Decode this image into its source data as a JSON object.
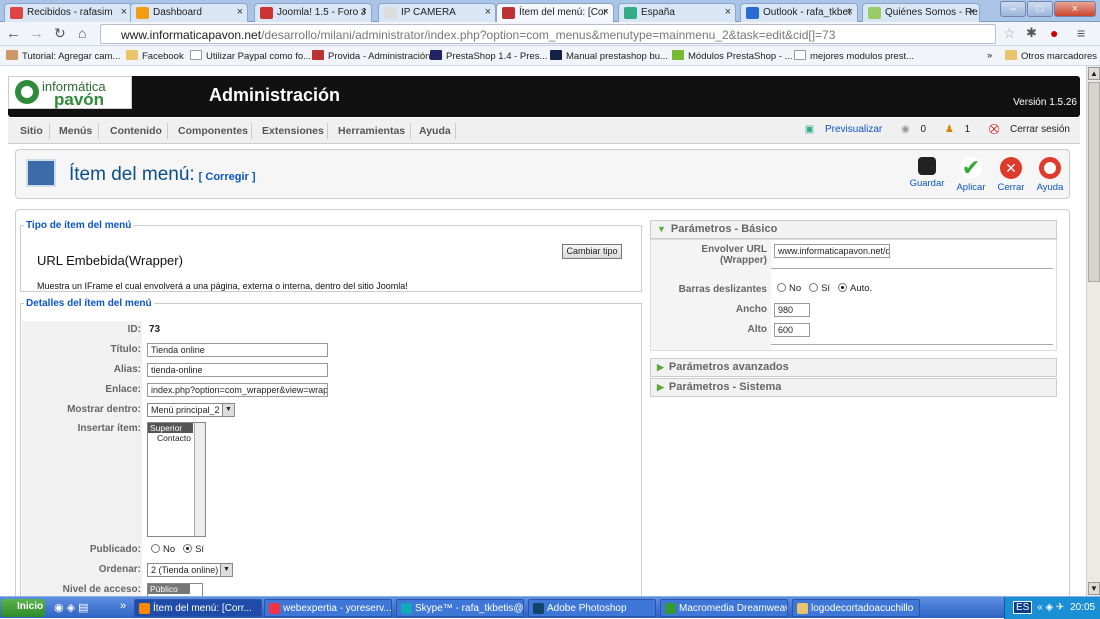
{
  "browser": {
    "tabs": [
      {
        "label": "Recibidos - rafasim",
        "icon_color": "#d44"
      },
      {
        "label": "Dashboard",
        "icon_color": "#f39c12"
      },
      {
        "label": "Joomla! 1.5 - Foro J",
        "icon_color": "#c33"
      },
      {
        "label": "IP CAMERA",
        "icon_color": "#ddd"
      },
      {
        "label": "Ítem del menú: [Cor",
        "icon_color": "#b33"
      },
      {
        "label": "España",
        "icon_color": "#3a8"
      },
      {
        "label": "Outlook - rafa_tkbet",
        "icon_color": "#2a6bd1"
      },
      {
        "label": "Quiénes Somos - Re",
        "icon_color": "#9c6"
      }
    ],
    "url_host": "www.informaticapavon.net",
    "url_path": "/desarrollo/milani/administrator/index.php?option=com_menus&menutype=mainmenu_2&task=edit&cid[]=73",
    "bookmarks": [
      "Tutorial: Agregar cam...",
      "Facebook",
      "Utilizar Paypal como fo...",
      "Provida - Administración",
      "PrestaShop 1.4 - Pres...",
      "Manual prestashop bu...",
      "Módulos PrestaShop - ...",
      "mejores modulos prest..."
    ],
    "bookmarks_overflow": "»",
    "other_bookmarks": "Otros marcadores"
  },
  "header": {
    "logo_top": "informática",
    "logo_bottom": "pavón",
    "title": "Administración",
    "version": "Versión 1.5.26"
  },
  "menu": {
    "items": [
      "Sitio",
      "Menús",
      "Contenido",
      "Componentes",
      "Extensiones",
      "Herramientas",
      "Ayuda"
    ],
    "preview": "Previsualizar",
    "messages_count": "0",
    "users_count": "1",
    "logout": "Cerrar sesión"
  },
  "toolbar": {
    "title": "Ítem del menú:",
    "subtitle": "[ Corregir ]",
    "buttons": [
      "Guardar",
      "Aplicar",
      "Cerrar",
      "Ayuda"
    ]
  },
  "tipo": {
    "legend": "Tipo de ítem del menú",
    "name": "URL Embebida(Wrapper)",
    "change_button": "Cambiar tipo",
    "description": "Muestra un IFrame el cual envolverá a una página, externa o interna, dentro del sitio Joomla!"
  },
  "detalles": {
    "legend": "Detalles del ítem del menú",
    "id_label": "ID:",
    "id_value": "73",
    "titulo_label": "Título:",
    "titulo_value": "Tienda online",
    "alias_label": "Alias:",
    "alias_value": "tienda-online",
    "enlace_label": "Enlace:",
    "enlace_value": "index.php?option=com_wrapper&view=wrapper",
    "mostrar_label": "Mostrar dentro:",
    "mostrar_value": "Menú principal_2",
    "insertar_label": "Insertar ítem:",
    "insertar_options": [
      "Superior",
      "Contacto"
    ],
    "publicado_label": "Publicado:",
    "no": "No",
    "si": "Sí",
    "ordenar_label": "Ordenar:",
    "ordenar_value": "2 (Tienda online)",
    "nivel_label": "Nivel de acceso:",
    "nivel_value": "Público"
  },
  "params_basic": {
    "title": "Parámetros - Básico",
    "url_label": "Envolver URL (Wrapper)",
    "url_value": "www.informaticapavon.net/des",
    "barras_label": "Barras deslizantes",
    "no": "No",
    "si": "Sí",
    "auto": "Auto.",
    "ancho_label": "Ancho",
    "ancho_value": "980",
    "alto_label": "Alto",
    "alto_value": "600"
  },
  "params_adv": "Parámetros avanzados",
  "params_sys": "Parámetros - Sistema",
  "taskbar": {
    "start": "Inicio",
    "overflow": "»",
    "tasks": [
      "Ítem del menú: [Corr...",
      "webexpertia - yoreserv...",
      "Skype™ - rafa_tkbetis@...",
      "Adobe Photoshop",
      "Macromedia Dreamweav...",
      "logodecortadoacuchillo"
    ],
    "lang": "ES",
    "clock": "20:05"
  }
}
